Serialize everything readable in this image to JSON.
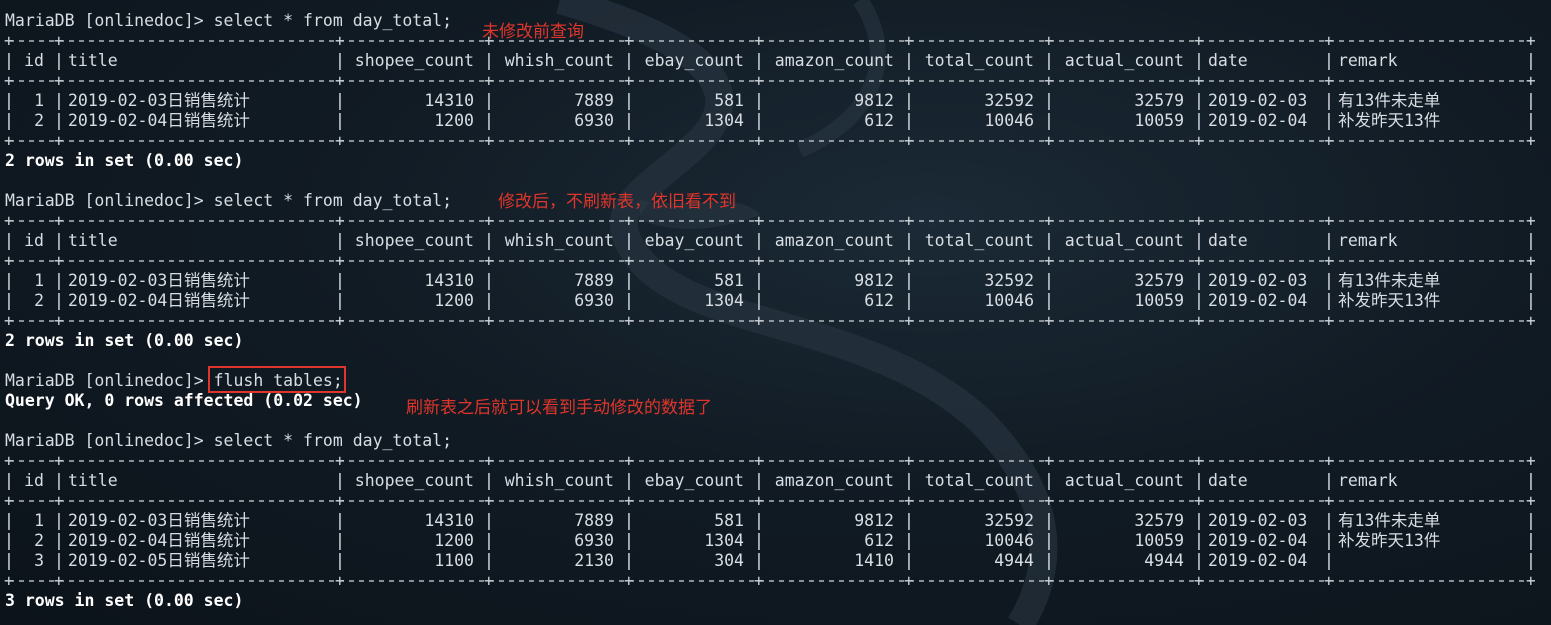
{
  "terminal": {
    "prompt": "MariaDB [onlinedoc]> ",
    "query_1": "select * from day_total;",
    "query_2": "select * from day_total;",
    "query_3": "flush tables;",
    "query_3_result": "Query OK, 0 rows affected (0.02 sec)",
    "query_4": "select * from day_total;",
    "result_1_footer": "2 rows in set (0.00 sec)",
    "result_2_footer": "2 rows in set (0.00 sec)",
    "result_4_footer": "3 rows in set (0.00 sec)"
  },
  "annotations": {
    "before_edit": "未修改前查询",
    "after_edit_no_flush": "修改后，不刷新表，依旧看不到",
    "after_flush": "刷新表之后就可以看到手动修改的数据了"
  },
  "table": {
    "columns": [
      "id",
      "title",
      "shopee_count",
      "whish_count",
      "ebay_count",
      "amazon_count",
      "total_count",
      "actual_count",
      "date",
      "remark"
    ],
    "rows_initial": [
      [
        "1",
        "2019-02-03日销售统计",
        "14310",
        "7889",
        "581",
        "9812",
        "32592",
        "32579",
        "2019-02-03",
        "有13件未走单"
      ],
      [
        "2",
        "2019-02-04日销售统计",
        "1200",
        "6930",
        "1304",
        "612",
        "10046",
        "10059",
        "2019-02-04",
        "补发昨天13件"
      ]
    ],
    "rows_after_flush": [
      [
        "1",
        "2019-02-03日销售统计",
        "14310",
        "7889",
        "581",
        "9812",
        "32592",
        "32579",
        "2019-02-03",
        "有13件未走单"
      ],
      [
        "2",
        "2019-02-04日销售统计",
        "1200",
        "6930",
        "1304",
        "612",
        "10046",
        "10059",
        "2019-02-04",
        "补发昨天13件"
      ],
      [
        "3",
        "2019-02-05日销售统计",
        "1100",
        "2130",
        "304",
        "1410",
        "4944",
        "4944",
        "2019-02-04",
        ""
      ]
    ]
  }
}
